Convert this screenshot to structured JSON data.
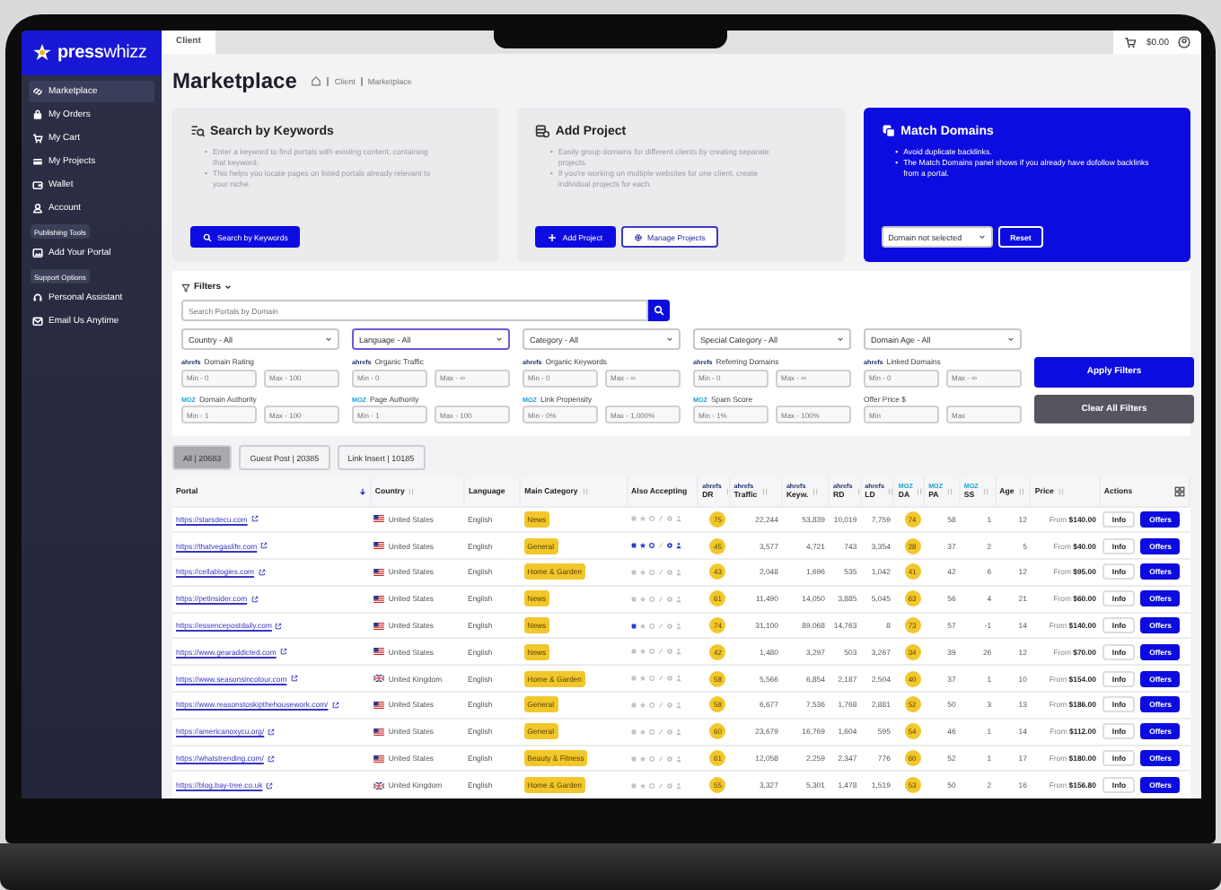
{
  "sidebar": {
    "logo": "**press**whizz",
    "items": [
      {
        "kind": "item",
        "label": "Marketplace",
        "selected": true
      },
      {
        "kind": "item",
        "label": "My Orders",
        "selected": false
      },
      {
        "kind": "item",
        "label": "My Cart",
        "selected": false
      },
      {
        "kind": "item",
        "label": "My Projects",
        "selected": false
      },
      {
        "kind": "item",
        "label": "Wallet",
        "selected": false
      },
      {
        "kind": "item",
        "label": "Account",
        "selected": false
      },
      {
        "kind": "section",
        "label": "Publishing Tools"
      },
      {
        "kind": "item",
        "label": "Add Your Portal",
        "selected": false
      },
      {
        "kind": "section",
        "label": "Support Options"
      },
      {
        "kind": "item",
        "label": "Personal Assistant",
        "selected": false
      },
      {
        "kind": "item",
        "label": "Email Us Anytime",
        "selected": false
      }
    ]
  },
  "topbar": {
    "tabs": [
      {
        "label": "Client",
        "selected": true
      }
    ],
    "cart_total": "$0.00"
  },
  "page": {
    "title": "Marketplace",
    "breadcrumb": [
      "Client",
      "Marketplace"
    ]
  },
  "cards": [
    {
      "kind": "plain",
      "title": "Search by Keywords",
      "bullets": [
        {
          "marker": "•",
          "text": "Enter a keyword to find portals with existing content, containing that keyword."
        },
        {
          "marker": "•",
          "text": "This helps you locate pages on listed portals already relevant to your niche."
        }
      ],
      "buttons": [
        {
          "kind": "primary",
          "label": "Search by Keywords"
        }
      ]
    },
    {
      "kind": "plain",
      "title": "Add Project",
      "bullets": [
        {
          "marker": "•",
          "text": "Easily group domains for different clients by creating separate projects."
        },
        {
          "marker": "•",
          "text": "If you're working on multiple websites for one client, create individual projects for each."
        }
      ],
      "buttons": [
        {
          "kind": "primary",
          "label": "Add Project"
        },
        {
          "kind": "outline",
          "label": "Manage Projects"
        }
      ]
    },
    {
      "kind": "highlight",
      "title": "Match Domains",
      "bullets": [
        {
          "marker": "•",
          "text": "Avoid duplicate backlinks."
        },
        {
          "marker": "•",
          "text": "The Match Domains panel shows if you already have dofollow backlinks from a portal."
        }
      ],
      "select": "Domain not selected",
      "buttons": [
        {
          "kind": "light",
          "label": "Reset"
        }
      ]
    }
  ],
  "filters": {
    "title": "Filters",
    "search": {
      "placeholder": "Search Portals by Domain"
    },
    "selects": [
      {
        "label": "Country - All",
        "focused": false
      },
      {
        "label": "Language - All",
        "focused": true
      },
      {
        "label": "Category - All",
        "focused": false
      },
      {
        "label": "Special Category - All",
        "focused": false
      },
      {
        "label": "Domain Age - All",
        "focused": false
      }
    ],
    "ranges": [
      {
        "source": "ahrefs",
        "label": "Domain Rating",
        "min_placeholder": "Min - 0",
        "max_placeholder": "Max - 100"
      },
      {
        "source": "ahrefs",
        "label": "Organic Traffic",
        "min_placeholder": "Min - 0",
        "max_placeholder": "Max - ∞"
      },
      {
        "source": "ahrefs",
        "label": "Organic Keywords",
        "min_placeholder": "Min - 0",
        "max_placeholder": "Max - ∞"
      },
      {
        "source": "ahrefs",
        "label": "Referring Domains",
        "min_placeholder": "Min - 0",
        "max_placeholder": "Max - ∞"
      },
      {
        "source": "ahrefs",
        "label": "Linked Domains",
        "min_placeholder": "Min - 0",
        "max_placeholder": "Max - ∞"
      },
      {
        "source": "MOZ",
        "label": "Domain Authority",
        "min_placeholder": "Min - 1",
        "max_placeholder": "Max - 100"
      },
      {
        "source": "MOZ",
        "label": "Page Authority",
        "min_placeholder": "Min - 1",
        "max_placeholder": "Max - 100"
      },
      {
        "source": "MOZ",
        "label": "Link Propensity",
        "min_placeholder": "Min - 0%",
        "max_placeholder": "Max - 1,000%"
      },
      {
        "source": "MOZ",
        "label": "Spam Score",
        "min_placeholder": "Min - 1%",
        "max_placeholder": "Max - 100%"
      },
      {
        "label": "Offer Price $",
        "min_placeholder": "Min",
        "max_placeholder": "Max"
      }
    ],
    "buttons": [
      {
        "kind": "primary",
        "label": "Apply Filters"
      },
      {
        "kind": "secondary",
        "label": "Clear All Filters"
      }
    ]
  },
  "result_tabs": [
    {
      "label": "All | 20683",
      "selected": true
    },
    {
      "label": "Guest Post | 20385",
      "selected": false
    },
    {
      "label": "Link Insert | 10185",
      "selected": false
    }
  ],
  "table": {
    "columns": [
      {
        "label": "Portal",
        "sorted": true
      },
      {
        "label": "Country",
        "sorted": false
      },
      {
        "label": "Language"
      },
      {
        "label": "Main Category",
        "sorted": false
      },
      {
        "label": "Also Accepting"
      },
      {
        "label": "DR",
        "source": "ahrefs",
        "sorted": false
      },
      {
        "label": "Traffic",
        "source": "ahrefs",
        "sorted": false
      },
      {
        "label": "Keyw.",
        "source": "ahrefs",
        "sorted": false
      },
      {
        "label": "RD",
        "source": "ahrefs",
        "sorted": false
      },
      {
        "label": "LD",
        "source": "ahrefs",
        "sorted": false
      },
      {
        "label": "DA",
        "source": "MOZ",
        "sorted": false
      },
      {
        "label": "PA",
        "source": "MOZ",
        "sorted": false
      },
      {
        "label": "SS",
        "source": "MOZ",
        "sorted": false
      },
      {
        "label": "Age",
        "sorted": false
      },
      {
        "label": "Price",
        "sorted": false
      },
      {
        "label": "Actions"
      }
    ],
    "rows": [
      {
        "portal": "https://starsdecu.com",
        "country": {
          "kind": "us",
          "name": "United States"
        },
        "language": "English",
        "category": "News",
        "accepting": [
          false,
          false,
          false,
          false,
          false,
          false
        ],
        "dr": "75",
        "traffic": "22,244",
        "keywords": "53,839",
        "rd": "10,019",
        "ld": "7,759",
        "da": "74",
        "pa": "58",
        "ss": "1",
        "age": "12",
        "price": "From **$140.00**",
        "actions": [
          "Info",
          "Offers"
        ]
      },
      {
        "portal": "https://thatvegaslife.com",
        "country": {
          "kind": "us",
          "name": "United States"
        },
        "language": "English",
        "category": "General",
        "accepting": [
          true,
          true,
          true,
          false,
          true,
          true
        ],
        "dr": "45",
        "traffic": "3,577",
        "keywords": "4,721",
        "rd": "743",
        "ld": "3,354",
        "da": "28",
        "pa": "37",
        "ss": "2",
        "age": "5",
        "price": "From **$40.00**",
        "actions": [
          "Info",
          "Offers"
        ]
      },
      {
        "portal": "https://cellablogies.com",
        "country": {
          "kind": "us",
          "name": "United States"
        },
        "language": "English",
        "category": "Home & Garden",
        "accepting": [
          false,
          false,
          false,
          false,
          false,
          false
        ],
        "dr": "43",
        "traffic": "2,048",
        "keywords": "1,696",
        "rd": "535",
        "ld": "1,042",
        "da": "41",
        "pa": "42",
        "ss": "6",
        "age": "12",
        "price": "From **$95.00**",
        "actions": [
          "Info",
          "Offers"
        ]
      },
      {
        "portal": "https://petinsider.com",
        "country": {
          "kind": "us",
          "name": "United States"
        },
        "language": "English",
        "category": "News",
        "accepting": [
          false,
          false,
          false,
          false,
          false,
          false
        ],
        "dr": "61",
        "traffic": "11,490",
        "keywords": "14,050",
        "rd": "3,885",
        "ld": "5,045",
        "da": "63",
        "pa": "56",
        "ss": "4",
        "age": "21",
        "price": "From **$60.00**",
        "actions": [
          "Info",
          "Offers"
        ]
      },
      {
        "portal": "https://essencepostdaily.com",
        "country": {
          "kind": "us",
          "name": "United States"
        },
        "language": "English",
        "category": "News",
        "accepting": [
          true,
          false,
          false,
          false,
          false,
          false
        ],
        "dr": "74",
        "traffic": "31,100",
        "keywords": "89,068",
        "rd": "14,763",
        "ld": "8",
        "da": "73",
        "pa": "57",
        "ss": "-1",
        "age": "14",
        "price": "From **$140.00**",
        "actions": [
          "Info",
          "Offers"
        ]
      },
      {
        "portal": "https://www.gearaddicted.com",
        "country": {
          "kind": "us",
          "name": "United States"
        },
        "language": "English",
        "category": "News",
        "accepting": [
          false,
          false,
          false,
          false,
          false,
          false
        ],
        "dr": "42",
        "traffic": "1,480",
        "keywords": "3,297",
        "rd": "503",
        "ld": "3,267",
        "da": "34",
        "pa": "39",
        "ss": "26",
        "age": "12",
        "price": "From **$70.00**",
        "actions": [
          "Info",
          "Offers"
        ]
      },
      {
        "portal": "https://www.seasonsincolour.com",
        "country": {
          "kind": "uk",
          "name": "United Kingdom"
        },
        "language": "English",
        "category": "Home & Garden",
        "accepting": [
          false,
          false,
          false,
          false,
          false,
          false
        ],
        "dr": "58",
        "traffic": "5,566",
        "keywords": "6,854",
        "rd": "2,187",
        "ld": "2,504",
        "da": "40",
        "pa": "37",
        "ss": "1",
        "age": "10",
        "price": "From **$154.00**",
        "actions": [
          "Info",
          "Offers"
        ]
      },
      {
        "portal": "https://www.reasonstoskipthehousework.com/",
        "country": {
          "kind": "us",
          "name": "United States"
        },
        "language": "English",
        "category": "General",
        "accepting": [
          false,
          false,
          false,
          false,
          false,
          false
        ],
        "dr": "58",
        "traffic": "6,677",
        "keywords": "7,536",
        "rd": "1,768",
        "ld": "2,881",
        "da": "52",
        "pa": "50",
        "ss": "3",
        "age": "13",
        "price": "From **$186.00**",
        "actions": [
          "Info",
          "Offers"
        ]
      },
      {
        "portal": "https://americanoxycu.org/",
        "country": {
          "kind": "us",
          "name": "United States"
        },
        "language": "English",
        "category": "General",
        "accepting": [
          false,
          false,
          false,
          false,
          false,
          false
        ],
        "dr": "60",
        "traffic": "23,679",
        "keywords": "16,769",
        "rd": "1,604",
        "ld": "595",
        "da": "54",
        "pa": "46",
        "ss": "1",
        "age": "14",
        "price": "From **$112.00**",
        "actions": [
          "Info",
          "Offers"
        ]
      },
      {
        "portal": "https://whatstrending.com/",
        "country": {
          "kind": "us",
          "name": "United States"
        },
        "language": "English",
        "category": "Beauty & Fitness",
        "accepting": [
          false,
          false,
          false,
          false,
          false,
          false
        ],
        "dr": "61",
        "traffic": "12,058",
        "keywords": "2,259",
        "rd": "2,347",
        "ld": "776",
        "da": "60",
        "pa": "52",
        "ss": "1",
        "age": "17",
        "price": "From **$180.00**",
        "actions": [
          "Info",
          "Offers"
        ]
      },
      {
        "portal": "https://blog.bay-tree.co.uk",
        "country": {
          "kind": "uk",
          "name": "United Kingdom"
        },
        "language": "English",
        "category": "Home & Garden",
        "accepting": [
          false,
          false,
          false,
          false,
          false,
          false
        ],
        "dr": "55",
        "traffic": "3,327",
        "keywords": "5,301",
        "rd": "1,478",
        "ld": "1,519",
        "da": "53",
        "pa": "50",
        "ss": "2",
        "age": "16",
        "price": "From **$156.80**",
        "actions": [
          "Info",
          "Offers"
        ]
      }
    ]
  }
}
